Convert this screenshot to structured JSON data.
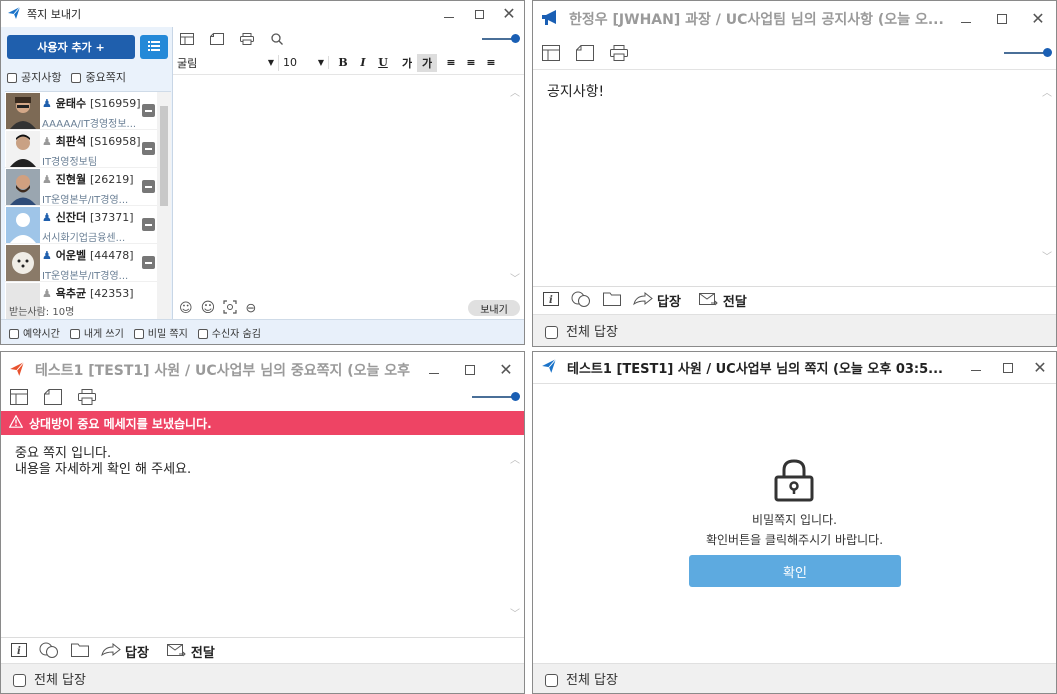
{
  "send_window": {
    "title": "쪽지 보내기",
    "add_user_label": "사용자 추가 +",
    "opt_notice": "공지사항",
    "opt_important": "중요쪽지",
    "users": [
      {
        "name": "윤태수",
        "code": "[S16959]",
        "dept": "AAAAA/IT경영정보..."
      },
      {
        "name": "최판석",
        "code": "[S16958]",
        "dept": "IT경영정보팀"
      },
      {
        "name": "진현월",
        "code": "[26219]",
        "dept": "IT운영본부/IT경영..."
      },
      {
        "name": "신잔더",
        "code": "[37371]",
        "dept": "서시화기업금융센..."
      },
      {
        "name": "어운벨",
        "code": "[44478]",
        "dept": "IT운영본부/IT경영..."
      },
      {
        "name": "욕추균",
        "code": "[42353]",
        "dept": ""
      }
    ],
    "font_name": "굴림",
    "font_size": "10",
    "recipients": "받는사람: 10명",
    "send_label": "보내기",
    "bottom_opts": [
      "예약시간",
      "내게 쓰기",
      "비밀 쪽지",
      "수신자 숨김"
    ]
  },
  "notice_window": {
    "title": "한정우 [JWHAN] 과장 / UC사업팀 님의 공지사항 (오늘 오...",
    "body": "공지사항!",
    "reply_label": "답장",
    "forward_label": "전달",
    "reply_all_label": "전체 답장"
  },
  "important_window": {
    "title": "테스트1 [TEST1] 사원 / UC사업부 님의 중요쪽지 (오늘 오후 ...",
    "alert": "상대방이 중요 메세지를 보냈습니다.",
    "body_line1": "중요 쪽지 입니다.",
    "body_line2": "내용을 자세하게 확인 해 주세요.",
    "reply_label": "답장",
    "forward_label": "전달",
    "reply_all_label": "전체 답장"
  },
  "secret_window": {
    "title": "테스트1 [TEST1] 사원 / UC사업부 님의 쪽지 (오늘 오후 03:5...",
    "line1": "비밀쪽지 입니다.",
    "line2": "확인버튼을 클릭해주시기 바랍니다.",
    "confirm_label": "확인",
    "reply_all_label": "전체 답장"
  },
  "colors": {
    "accent": "#1f5fad",
    "alert": "#ee4464",
    "confirm": "#5daae0",
    "send_icon": "#1a73c9",
    "important_icon": "#e8532f"
  },
  "icons": [
    "paper-plane-icon",
    "megaphone-icon",
    "layout-icon",
    "note-icon",
    "print-icon",
    "search-icon",
    "info-icon",
    "chat-icon",
    "folder-icon",
    "reply-icon",
    "forward-icon",
    "lock-icon",
    "warning-icon",
    "emoji-icon",
    "capture-icon",
    "attach-icon",
    "list-icon",
    "person-icon"
  ]
}
